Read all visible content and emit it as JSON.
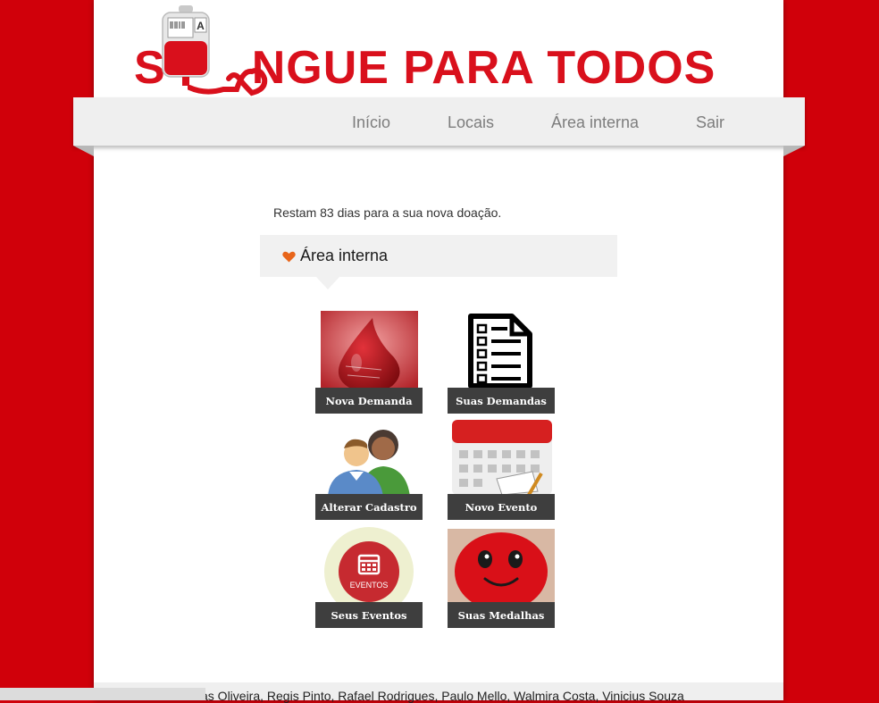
{
  "brand": {
    "logo_text_start": "S",
    "logo_text_end": "NGUE PARA TODOS",
    "bag_letter": "A",
    "color": "#d9101c"
  },
  "nav": {
    "items": [
      {
        "label": "Início"
      },
      {
        "label": "Locais"
      },
      {
        "label": "Área interna"
      },
      {
        "label": "Sair"
      }
    ]
  },
  "main": {
    "countdown": "Restam 83 dias para a sua nova doação.",
    "section_title": "Área interna",
    "tiles": [
      {
        "label": "Nova Demanda",
        "icon": "blood-drop-icon"
      },
      {
        "label": "Suas Demandas",
        "icon": "checklist-document-icon"
      },
      {
        "label": "Alterar Cadastro",
        "icon": "users-icon"
      },
      {
        "label": "Novo Evento",
        "icon": "calendar-icon"
      },
      {
        "label": "Seus Eventos",
        "icon": "events-calendar-icon",
        "badge": "EVENTOS"
      },
      {
        "label": "Suas Medalhas",
        "icon": "smiling-drop-medal-icon"
      }
    ]
  },
  "footer": {
    "credits": "as Oliveira, Regis Pinto, Rafael Rodrigues, Paulo Mello, Walmira Costa, Vinicius Souza"
  },
  "colors": {
    "background": "#d0000a",
    "nav_bg": "#efefef",
    "tile_label_bg": "#3e3e3e"
  }
}
